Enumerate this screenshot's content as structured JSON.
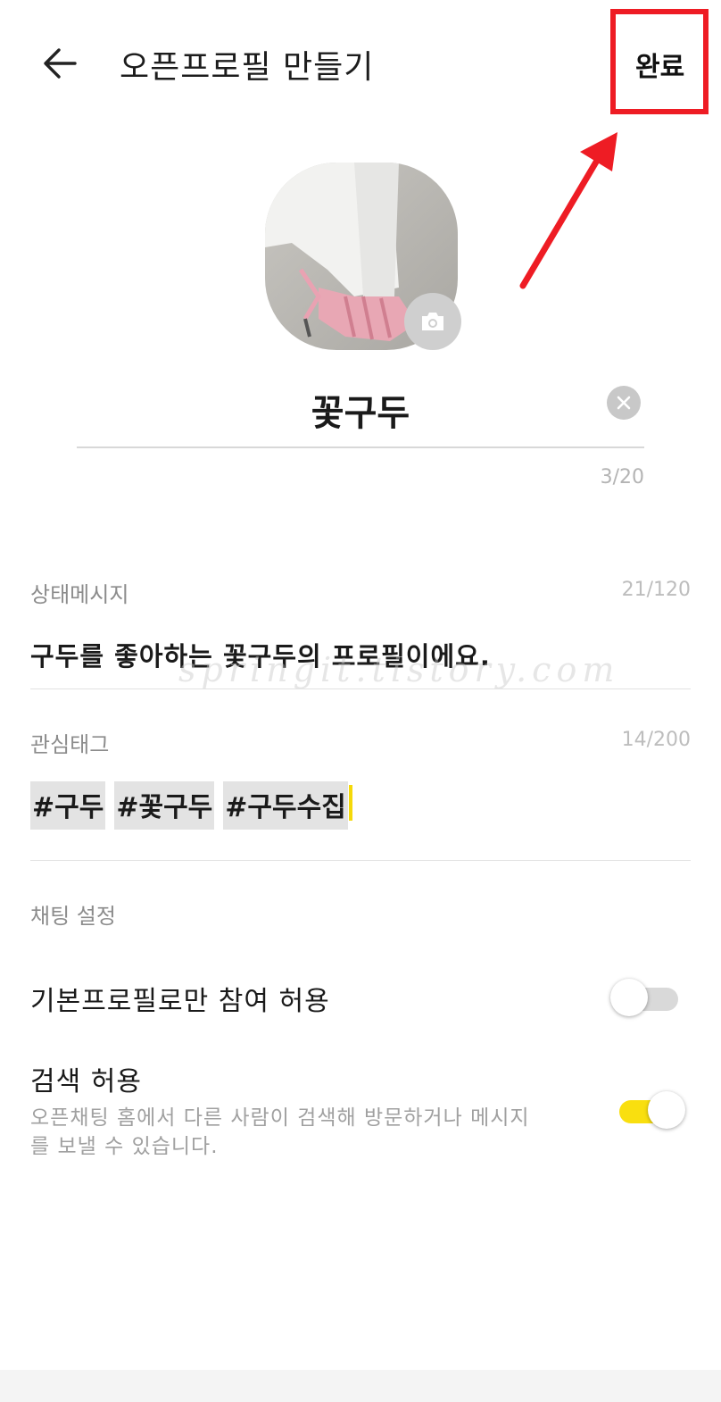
{
  "header": {
    "title": "오픈프로필 만들기",
    "done_label": "완료"
  },
  "profile": {
    "name": "꽃구두",
    "name_count": "3/20"
  },
  "status_message": {
    "label": "상태메시지",
    "count": "21/120",
    "value": "구두를 좋아하는 꽃구두의 프로필이에요."
  },
  "interest_tags": {
    "label": "관심태그",
    "count": "14/200",
    "tags": [
      "#구두",
      "#꽃구두",
      "#구두수집"
    ]
  },
  "chat_settings": {
    "section_label": "채팅 설정",
    "default_profile_only": {
      "label": "기본프로필로만 참여 허용",
      "enabled": false
    },
    "allow_search": {
      "label": "검색 허용",
      "description": "오픈채팅 홈에서 다른 사람이 검색해 방문하거나 메시지를 보낼 수 있습니다.",
      "enabled": true
    }
  },
  "watermark": "springit.tistory.com",
  "colors": {
    "accent_yellow": "#f9df0f",
    "annotation_red": "#ee1c24"
  }
}
